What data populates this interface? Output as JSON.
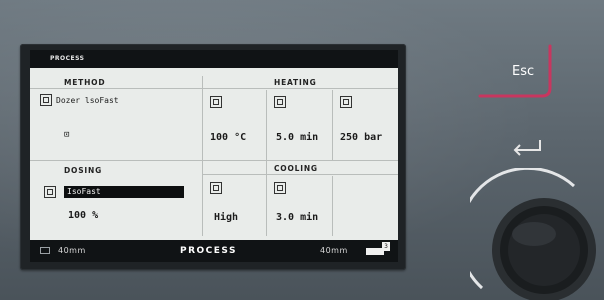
{
  "screen": {
    "header_label": "PROCESS",
    "method": {
      "title": "METHOD",
      "program_name": "Dozer lsoFast"
    },
    "heating": {
      "title": "HEATING",
      "temperature": "100 °C",
      "time": "5.0 min",
      "pressure": "250 bar"
    },
    "dosing": {
      "title": "DOSING",
      "program_name": "IsoFast",
      "amount": "100 %"
    },
    "cooling": {
      "title": "COOLING",
      "fan": "High",
      "time": "3.0 min"
    },
    "footer": {
      "left": "40mm",
      "center": "PROCESS",
      "right": "40mm",
      "badge": "3"
    }
  },
  "controls": {
    "esc_label": "Esc"
  },
  "colors": {
    "accent": "#c8365f",
    "lcd_background": "#e9ecea",
    "lcd_dark": "#101315"
  }
}
